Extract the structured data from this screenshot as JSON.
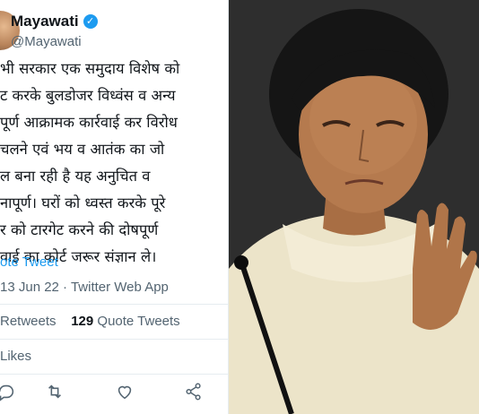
{
  "tweet": {
    "display_name": "Mayawati",
    "handle": "@Mayawati",
    "lines": [
      "भी सरकार एक समुदाय विशेष को",
      "ट करके बुलडोजर विध्वंस व अन्य",
      "पूर्ण आक्रामक कार्रवाई कर विरोध",
      "चलने एवं भय व आतंक का जो",
      "ल बना रही है यह अनुचित व",
      "नापूर्ण। घरों को ध्वस्त करके पूरे",
      "र को टारगेट करने की दोषपूर्ण",
      "वाई का कोर्ट जरूर संज्ञान ले।"
    ],
    "quote_link": "ote Tweet",
    "meta": "13 Jun 22 · Twitter Web App",
    "retweets_label": "Retweets",
    "quote_count": "129",
    "quote_label": "Quote Tweets",
    "likes_label": "Likes"
  },
  "actions": [
    "reply-icon",
    "retweet-icon",
    "like-icon",
    "share-icon"
  ],
  "colors": {
    "accent": "#1d9bf0",
    "text": "#0f1419",
    "muted": "#536471",
    "divider": "#e6ecf0"
  }
}
